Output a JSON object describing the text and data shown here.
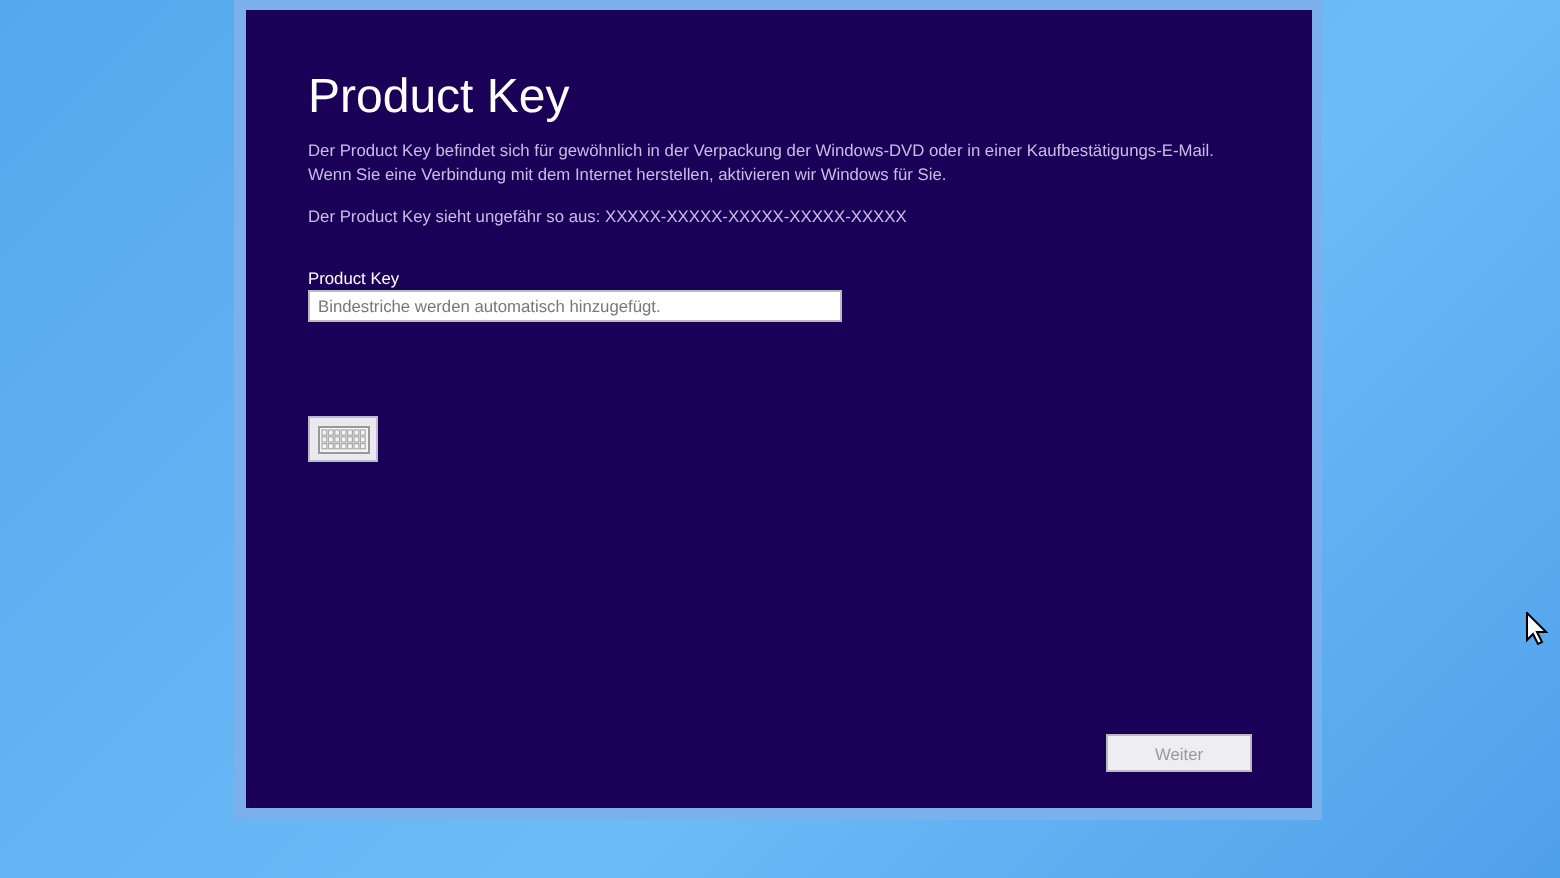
{
  "dialog": {
    "title": "Product Key",
    "description": "Der Product Key befindet sich für gewöhnlich in der Verpackung der Windows-DVD oder in einer Kaufbestätigungs-E-Mail. Wenn Sie eine Verbindung mit dem Internet herstellen, aktivieren wir Windows für Sie.",
    "example": "Der Product Key sieht ungefähr so aus: XXXXX-XXXXX-XXXXX-XXXXX-XXXXX",
    "field": {
      "label": "Product Key",
      "placeholder": "Bindestriche werden automatisch hinzugefügt."
    },
    "next_button": {
      "label": "Weiter",
      "disabled": true
    }
  }
}
